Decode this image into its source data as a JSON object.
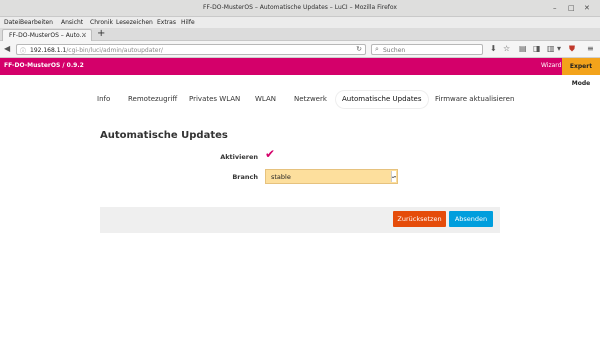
{
  "window": {
    "title": "FF-DO-MusterOS – Automatische Updates – LuCI – Mozilla Firefox"
  },
  "menu": [
    "Datei",
    "Bearbeiten",
    "Ansicht",
    "Chronik",
    "Lesezeichen",
    "Extras",
    "Hilfe"
  ],
  "tab": {
    "label": "FF-DO-MusterOS – Auto...",
    "close": "×",
    "new_tab": "+"
  },
  "navbar": {
    "url_host": "192.168.1.1",
    "url_path": "/cgi-bin/luci/admin/autoupdater/",
    "search_placeholder": "Suchen"
  },
  "appbar": {
    "brand": "FF-DO-MusterOS / 0.9.2",
    "wizard": "Wizard",
    "expert_mode": "Expert Mode"
  },
  "subnav": [
    "Info",
    "Remotezugriff",
    "Privates WLAN",
    "WLAN",
    "Netzwerk",
    "Automatische Updates",
    "Firmware aktualisieren"
  ],
  "subnav_active": "Automatische Updates",
  "form": {
    "title": "Automatische Updates",
    "enable_label": "Aktivieren",
    "enable_checked": true,
    "branch_label": "Branch",
    "branch_value": "stable"
  },
  "actions": {
    "reset": "Zurücksetzen",
    "save": "Absenden"
  },
  "colors": {
    "brand": "#d4006a",
    "expert": "#f3a31b",
    "reset": "#e54c0a",
    "save": "#009edd",
    "select_bg": "#fddf9d"
  }
}
